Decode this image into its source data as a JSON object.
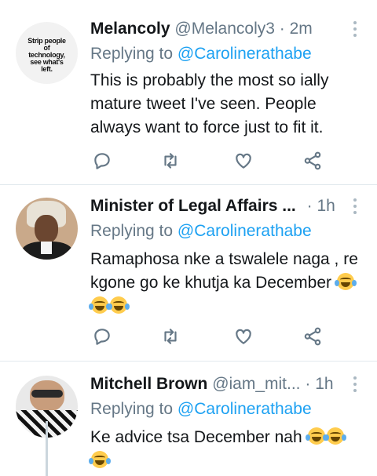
{
  "tweets": [
    {
      "name": "Melancoly",
      "handle": "@Melancoly3",
      "dot": "·",
      "time": "2m",
      "replying_prefix": "Replying to",
      "replying_to": "@Carolinerathabe",
      "text": "This is probably the most so ially mature tweet I've seen. People always want to force just to fit it.",
      "avatar_text": "Strip people of technology, see what's left."
    },
    {
      "name": "Minister of Legal Affairs ...",
      "handle": "",
      "dot": "·",
      "time": "1h",
      "replying_prefix": "Replying to",
      "replying_to": "@Carolinerathabe",
      "text": "Ramaphosa nke a tswalele naga , re kgone go ke khutja ka December"
    },
    {
      "name": "Mitchell Brown",
      "handle": "@iam_mit...",
      "dot": "·",
      "time": "1h",
      "replying_prefix": "Replying to",
      "replying_to": "@Carolinerathabe",
      "text": "Ke advice tsa December nah"
    }
  ],
  "icons": {
    "reply": "reply-icon",
    "retweet": "retweet-icon",
    "like": "heart-icon",
    "share": "share-icon",
    "more": "more-vertical-icon",
    "emoji_rofl": "rolling-laughing-emoji",
    "emoji_joy": "tears-of-joy-emoji"
  },
  "colors": {
    "link": "#1da1f2",
    "secondary": "#657786",
    "divider": "#e1e8ed"
  }
}
